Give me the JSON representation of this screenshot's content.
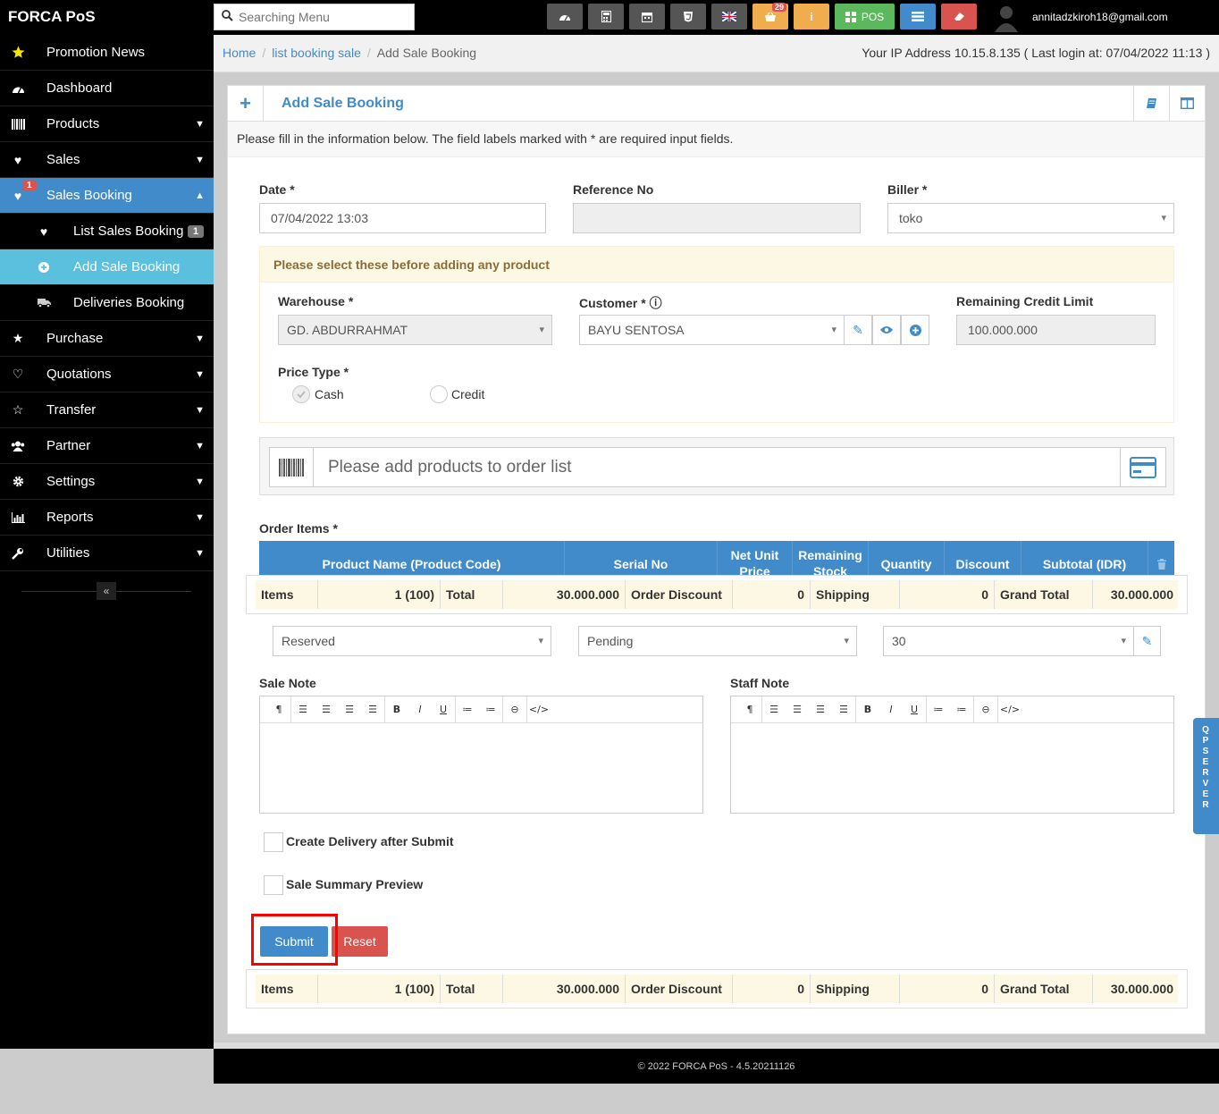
{
  "app": {
    "brand": "FORCA PoS",
    "user_email": "annitadzkiroh18@gmail.com",
    "notif_count": "29"
  },
  "search": {
    "placeholder": "Searching Menu"
  },
  "topbar": {
    "pos_label": "POS"
  },
  "sidebar": {
    "items": [
      {
        "label": "Promotion News"
      },
      {
        "label": "Dashboard"
      },
      {
        "label": "Products"
      },
      {
        "label": "Sales"
      },
      {
        "label": "Sales Booking",
        "badge": "1"
      },
      {
        "label": "List Sales Booking",
        "badge": "1"
      },
      {
        "label": "Add Sale Booking"
      },
      {
        "label": "Deliveries Booking"
      },
      {
        "label": "Purchase"
      },
      {
        "label": "Quotations"
      },
      {
        "label": "Transfer"
      },
      {
        "label": "Partner"
      },
      {
        "label": "Settings"
      },
      {
        "label": "Reports"
      },
      {
        "label": "Utilities"
      }
    ],
    "collapse_label": "«"
  },
  "breadcrumb": {
    "home": "Home",
    "list": "list booking sale",
    "current": "Add Sale Booking"
  },
  "ip_info": "Your IP Address 10.15.8.135 ( Last login at: 07/04/2022 11:13 )",
  "panel": {
    "title": "Add Sale Booking",
    "intro": "Please fill in the information below. The field labels marked with * are required input fields."
  },
  "form": {
    "date_label": "Date *",
    "date_value": "07/04/2022 13:03",
    "ref_label": "Reference No",
    "ref_value": "",
    "biller_label": "Biller *",
    "biller_value": "toko",
    "pre_notice": "Please select these before adding any product",
    "warehouse_label": "Warehouse *",
    "warehouse_value": "GD. ABDURRAHMAT",
    "customer_label": "Customer *",
    "customer_value": "BAYU SENTOSA",
    "credit_label": "Remaining Credit Limit",
    "credit_value": "100.000.000",
    "price_type_label": "Price Type *",
    "price_cash": "Cash",
    "price_credit": "Credit",
    "add_product_placeholder": "Please add products to order list",
    "order_items_label": "Order Items *"
  },
  "order_table": {
    "headers": [
      "Product Name (Product Code)",
      "Serial No",
      "Net Unit Price",
      "Remaining Stock",
      "Quantity",
      "Discount",
      "Subtotal (IDR)"
    ]
  },
  "totals": {
    "items_label": "Items",
    "items_value": "1 (100)",
    "total_label": "Total",
    "total_value": "30.000.000",
    "order_discount_label": "Order Discount",
    "order_discount_value": "0",
    "shipping_label": "Shipping",
    "shipping_value": "0",
    "grand_total_label": "Grand Total",
    "grand_total_value": "30.000.000"
  },
  "status": {
    "reserved": "Reserved",
    "pending": "Pending",
    "term": "30"
  },
  "notes": {
    "sale_note_label": "Sale Note",
    "staff_note_label": "Staff Note"
  },
  "options": {
    "create_delivery": "Create Delivery after Submit",
    "summary_preview": "Sale Summary Preview"
  },
  "buttons": {
    "submit": "Submit",
    "reset": "Reset"
  },
  "footer": "© 2022 FORCA PoS - 4.5.20211126",
  "qp_server": "QP SERVER",
  "colors": {
    "primary": "#428bca",
    "info": "#5bc0de",
    "danger": "#d9534f",
    "warning": "#f0ad4e",
    "success": "#5cb85c"
  }
}
